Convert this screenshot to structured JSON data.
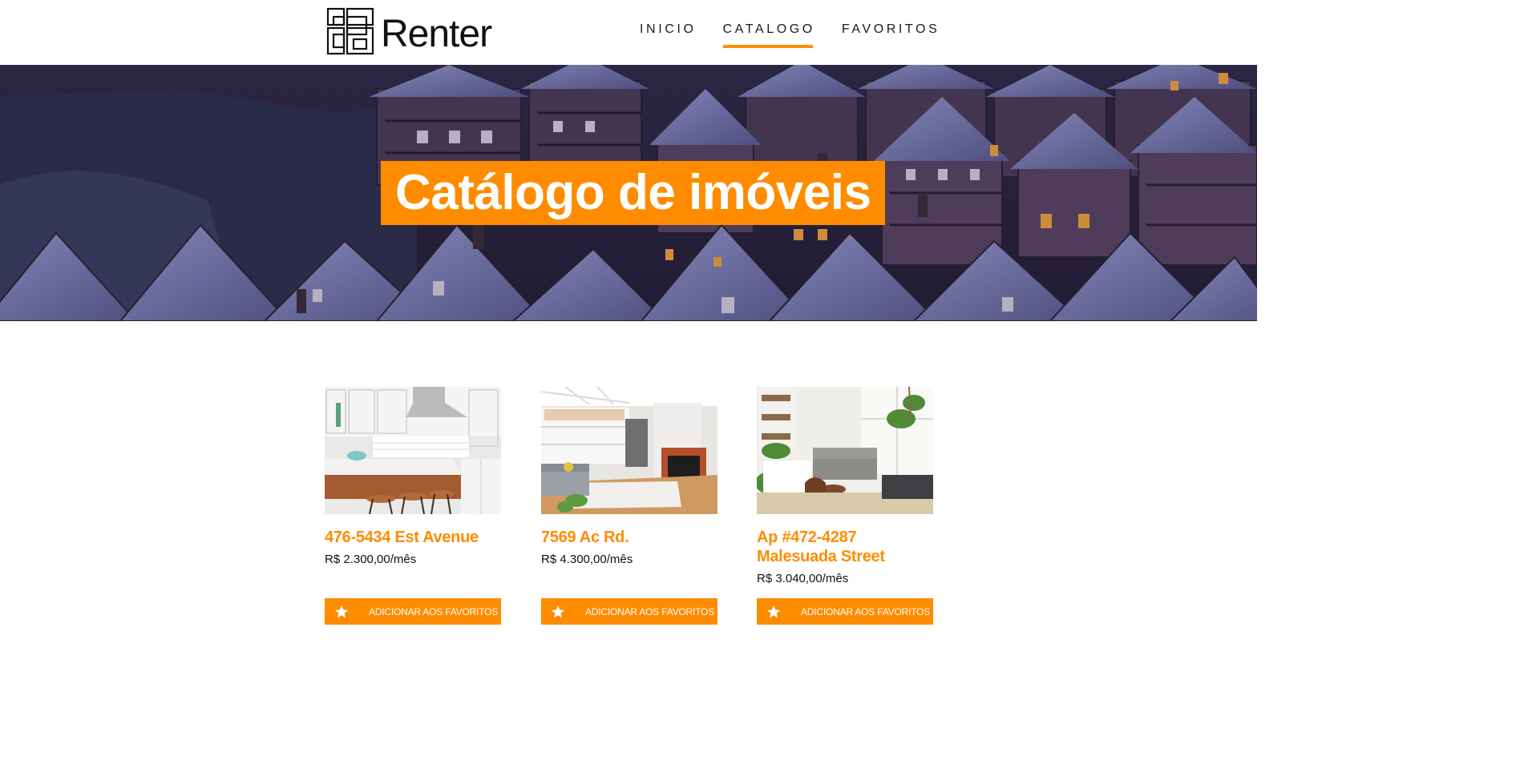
{
  "brand": {
    "name": "Renter",
    "accent": "#ff8c00"
  },
  "nav": {
    "items": [
      {
        "label": "INICIO",
        "active": false
      },
      {
        "label": "CATALOGO",
        "active": true
      },
      {
        "label": "FAVORITOS",
        "active": false
      }
    ]
  },
  "hero": {
    "title": "Catálogo de imóveis"
  },
  "catalog": {
    "cards": [
      {
        "title": "476-5434 Est Avenue",
        "price": "R$ 2.300,00/mês",
        "button_label": "ADICIONAR AOS FAVORITOS",
        "button_icon": "star-icon"
      },
      {
        "title": "7569 Ac Rd.",
        "price": "R$ 4.300,00/mês",
        "button_label": "ADICIONAR AOS FAVORITOS",
        "button_icon": "star-icon"
      },
      {
        "title": "Ap #472-4287 Malesuada Street",
        "price": "R$ 3.040,00/mês",
        "button_label": "ADICIONAR AOS FAVORITOS",
        "button_icon": "star-icon"
      }
    ]
  }
}
